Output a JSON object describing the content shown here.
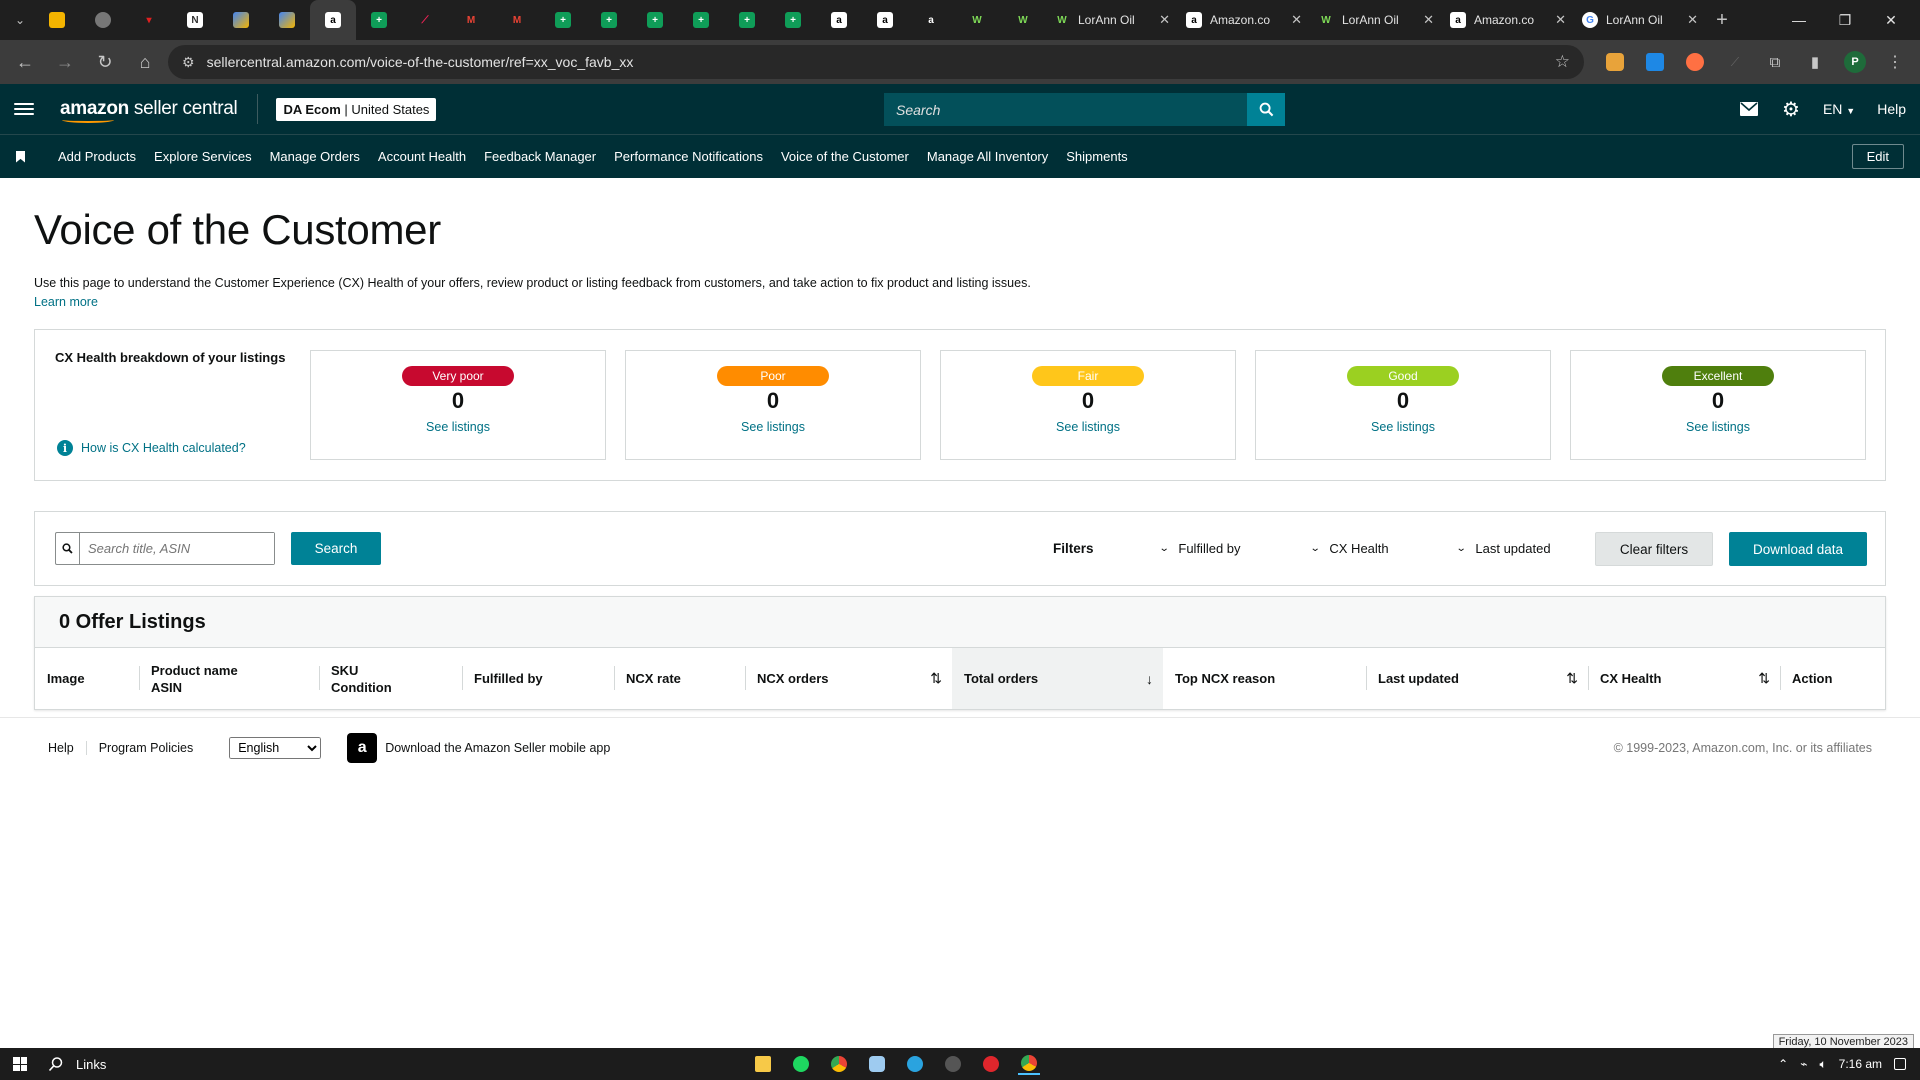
{
  "browser": {
    "tabs": [
      {
        "title": "LorAnn Oil",
        "icon": "lorann-favicon"
      },
      {
        "title": "Amazon.co",
        "icon": "amazon-favicon"
      },
      {
        "title": "LorAnn Oil",
        "icon": "lorann-favicon"
      },
      {
        "title": "Amazon.co",
        "icon": "amazon-favicon"
      },
      {
        "title": "LorAnn Oil",
        "icon": "google-favicon"
      }
    ],
    "url": "sellercentral.amazon.com/voice-of-the-customer/ref=xx_voc_favb_xx",
    "profile_initial": "P"
  },
  "header": {
    "logo_bold": "amazon",
    "logo_rest": " seller central",
    "store_name": "DA Ecom",
    "store_region": "United States",
    "search_placeholder": "Search",
    "language": "EN",
    "help": "Help"
  },
  "nav": {
    "items": [
      "Add Products",
      "Explore Services",
      "Manage Orders",
      "Account Health",
      "Feedback Manager",
      "Performance Notifications",
      "Voice of the Customer",
      "Manage All Inventory",
      "Shipments"
    ],
    "edit": "Edit"
  },
  "page": {
    "title": "Voice of the Customer",
    "description": "Use this page to understand the Customer Experience (CX) Health of your offers, review product or listing feedback from customers, and take action to fix product and listing issues.",
    "learn_more": "Learn more"
  },
  "cx_health": {
    "title": "CX Health breakdown of your listings",
    "how_link": "How is CX Health calculated?",
    "cards": [
      {
        "label": "Very poor",
        "count": "0",
        "link": "See listings",
        "color": "#c7092f"
      },
      {
        "label": "Poor",
        "count": "0",
        "link": "See listings",
        "color": "#ff8c00"
      },
      {
        "label": "Fair",
        "count": "0",
        "link": "See listings",
        "color": "#ffc61a"
      },
      {
        "label": "Good",
        "count": "0",
        "link": "See listings",
        "color": "#9bd021"
      },
      {
        "label": "Excellent",
        "count": "0",
        "link": "See listings",
        "color": "#4f7f0d"
      }
    ]
  },
  "filters": {
    "search_placeholder": "Search title, ASIN",
    "search_button": "Search",
    "label": "Filters",
    "fulfilled_by": "Fulfilled by",
    "cx_health": "CX Health",
    "last_updated": "Last updated",
    "clear": "Clear filters",
    "download": "Download data"
  },
  "listings": {
    "heading": "0 Offer Listings",
    "columns": {
      "image": "Image",
      "product_name": "Product name",
      "asin": "ASIN",
      "sku": "SKU",
      "condition": "Condition",
      "fulfilled_by": "Fulfilled by",
      "ncx_rate": "NCX rate",
      "ncx_orders": "NCX orders",
      "total_orders": "Total orders",
      "top_ncx_reason": "Top NCX reason",
      "last_updated": "Last updated",
      "cx_health": "CX Health",
      "action": "Action"
    }
  },
  "footer": {
    "help": "Help",
    "program_policies": "Program Policies",
    "language_selected": "English",
    "app_text": "Download the Amazon Seller mobile app",
    "copyright": "© 1999-2023, Amazon.com, Inc. or its affiliates"
  },
  "taskbar": {
    "search": "Links",
    "time": "7:16 am",
    "date_tooltip": "Friday, 10 November 2023"
  },
  "colors": {
    "header_bg": "#002f36",
    "accent": "#008296",
    "link": "#007185"
  }
}
